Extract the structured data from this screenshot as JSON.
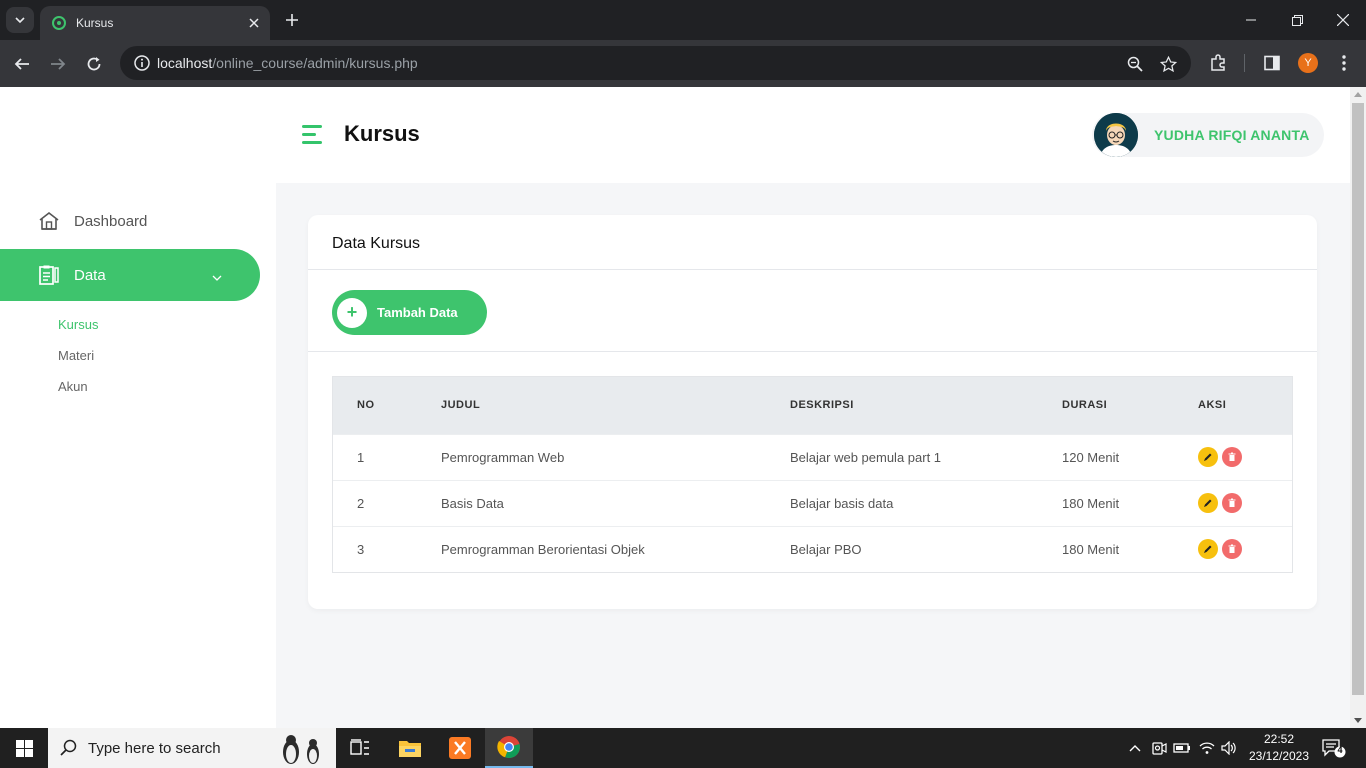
{
  "browser": {
    "tab_title": "Kursus",
    "url_host": "localhost",
    "url_path": "/online_course/admin/kursus.php",
    "profile_initial": "Y"
  },
  "header": {
    "page_title": "Kursus",
    "user_name": "YUDHA RIFQI ANANTA"
  },
  "sidebar": {
    "items": [
      {
        "label": "Dashboard",
        "icon": "home-icon"
      },
      {
        "label": "Data",
        "icon": "clipboard-icon"
      }
    ],
    "submenu": [
      "Kursus",
      "Materi",
      "Akun"
    ]
  },
  "card": {
    "title": "Data Kursus",
    "add_button": "Tambah Data",
    "plus": "+"
  },
  "table": {
    "headers": [
      "NO",
      "JUDUL",
      "DESKRIPSI",
      "DURASI",
      "AKSI"
    ],
    "rows": [
      {
        "no": "1",
        "judul": "Pemrogramman Web",
        "deskripsi": "Belajar web pemula part 1",
        "durasi": "120 Menit"
      },
      {
        "no": "2",
        "judul": "Basis Data",
        "deskripsi": "Belajar basis data",
        "durasi": "180 Menit"
      },
      {
        "no": "3",
        "judul": "Pemrogramman Berorientasi Objek",
        "deskripsi": "Belajar PBO",
        "durasi": "180 Menit"
      }
    ]
  },
  "taskbar": {
    "search_placeholder": "Type here to search",
    "time": "22:52",
    "date": "23/12/2023",
    "notification_count": "4"
  },
  "colors": {
    "accent": "#3ec46d",
    "edit": "#f7c00e",
    "delete": "#f26b6b"
  }
}
